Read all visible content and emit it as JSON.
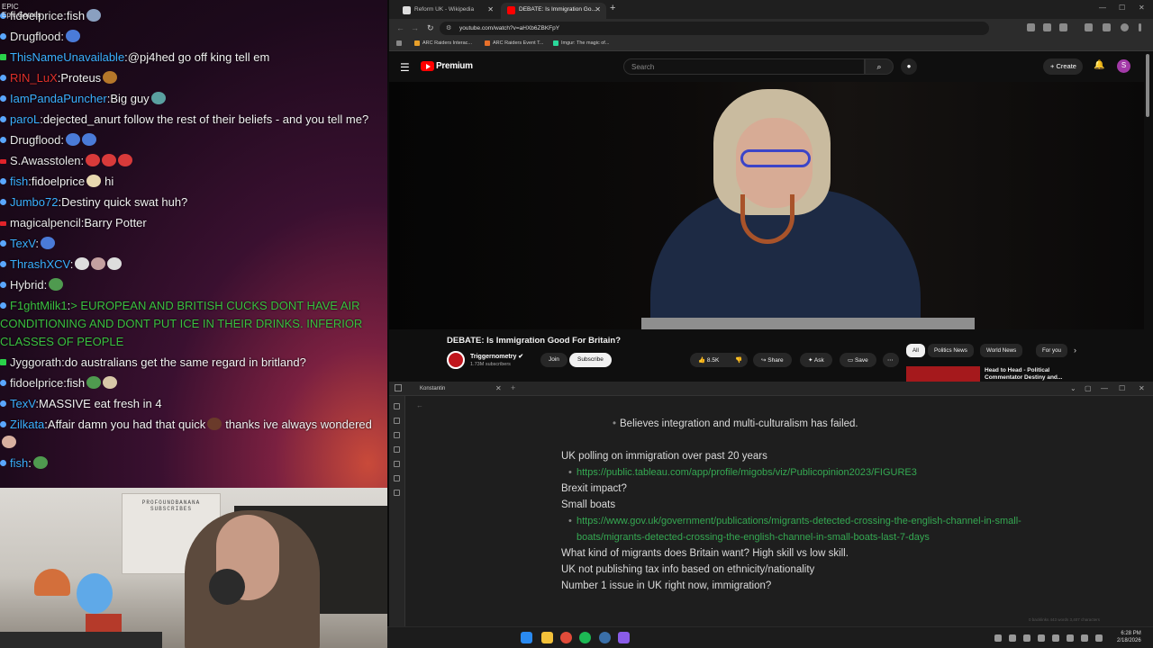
{
  "chat": {
    "epic_tag": "EPIC\nEpic Games",
    "messages": [
      {
        "badge": "sub",
        "user": "fidoelprice",
        "user_color": "#e8e8e8",
        "text": "fish",
        "emotes": [
          "#8aa0c0"
        ]
      },
      {
        "badge": "sub",
        "user": "Drugflood",
        "user_color": "#e8e8e8",
        "text": "",
        "emotes": [
          "#4a7bd8"
        ]
      },
      {
        "badge": "green",
        "user": "ThisNameUnavailable",
        "user_color": "#3ab0ff",
        "text": "@pj4hed go off king tell em",
        "emotes": []
      },
      {
        "badge": "sub",
        "user": "RIN_LuX",
        "user_color": "#e0302a",
        "text": "Proteus",
        "emotes": [
          "#b5772a"
        ]
      },
      {
        "badge": "sub",
        "user": "IamPandaPuncher",
        "user_color": "#3ab0ff",
        "text": "Big guy",
        "emotes": [
          "#5aa0a0"
        ]
      },
      {
        "badge": "sub",
        "user": "paroL",
        "user_color": "#3ab0ff",
        "text": "dejected_anurt follow the rest of their beliefs - and you tell me?",
        "emotes": []
      },
      {
        "badge": "sub",
        "user": "Drugflood",
        "user_color": "#e8e8e8",
        "text": "",
        "emotes": [
          "#4a7bd8",
          "#4a7bd8"
        ]
      },
      {
        "badge": "red",
        "user": "S.Awasstolen",
        "user_color": "#e8e8e8",
        "text": "",
        "emotes": [
          "#d83a3a",
          "#d83a3a",
          "#d83a3a"
        ]
      },
      {
        "badge": "sub",
        "user": "fish",
        "user_color": "#3ab0ff",
        "text": "fidoelprice",
        "emotes": [
          "#e8d8b0"
        ],
        "tail": "hi"
      },
      {
        "badge": "sub",
        "user": "Jumbo72",
        "user_color": "#3ab0ff",
        "text": "Destiny quick swat huh?",
        "emotes": []
      },
      {
        "badge": "red",
        "user": "magicalpencil",
        "user_color": "#e8e8e8",
        "text": "Barry Potter",
        "emotes": []
      },
      {
        "badge": "sub",
        "user": "TexV",
        "user_color": "#3ab0ff",
        "text": "",
        "emotes": [
          "#4a7bd8"
        ]
      },
      {
        "badge": "sub",
        "user": "ThrashXCV",
        "user_color": "#3ab0ff",
        "text": "",
        "emotes": [
          "#dddddd",
          "#c4a0a0",
          "#dddddd"
        ]
      },
      {
        "badge": "sub",
        "user": "Hybrid",
        "user_color": "#e8e8e8",
        "text": "",
        "emotes": [
          "#4f9a4f"
        ]
      },
      {
        "badge": "sub",
        "user": "F1ghtMilk1",
        "user_color": "#3ac040",
        "text": "> EUROPEAN AND BRITISH CUCKS DONT HAVE AIR CONDITIONING AND DONT PUT ICE IN THEIR DRINKS. INFERIOR CLASSES OF PEOPLE",
        "emotes": [],
        "shout": true
      },
      {
        "badge": "green",
        "user": "Jyggorath",
        "user_color": "#e8e8e8",
        "text": "do australians get the same regard in britland?",
        "emotes": []
      },
      {
        "badge": "sub",
        "user": "fidoelprice",
        "user_color": "#e8e8e8",
        "text": "fish",
        "emotes": [
          "#4f9a4f",
          "#d8c8a8"
        ]
      },
      {
        "badge": "sub",
        "user": "TexV",
        "user_color": "#3ab0ff",
        "text": "MASSIVE eat fresh in 4",
        "emotes": []
      },
      {
        "badge": "sub",
        "user": "Zilkata",
        "user_color": "#3ab0ff",
        "text": "Affair damn you had that quick",
        "emotes": [
          "#6a3a2a"
        ],
        "tail": "thanks ive always wondered",
        "tail_emotes": [
          "#d8b0a0"
        ]
      },
      {
        "badge": "sub",
        "user": "fish",
        "user_color": "#3ab0ff",
        "text": "",
        "emotes": [
          "#4f9a4f"
        ]
      }
    ]
  },
  "webcam": {
    "poster_text": "PROFOUNDBANANA SUBSCRIBES"
  },
  "browser": {
    "tabs": [
      {
        "title": "Reform UK - Wikipedia",
        "favicon_color": "#dddddd"
      },
      {
        "title": "DEBATE: Is Immigration Go...",
        "favicon_color": "#ff0000"
      }
    ],
    "url": "youtube.com/watch?v=aHXb6ZBKFpY",
    "bookmarks": [
      {
        "label": "ARC Raiders Interac...",
        "color": "#e8a02a"
      },
      {
        "label": "ARC Raiders Event T...",
        "color": "#e8702a"
      },
      {
        "label": "Imgur: The magic of...",
        "color": "#2ad89a"
      }
    ]
  },
  "youtube": {
    "brand": "Premium",
    "search_placeholder": "Search",
    "create_label": "Create",
    "avatar_letter": "S",
    "video_title": "DEBATE: Is Immigration Good For Britain?",
    "channel_name": "Triggernometry ✔",
    "channel_subs": "1.73M subscribers",
    "join_label": "Join",
    "subscribe_label": "Subscribe",
    "likes": "8.5K",
    "share_label": "Share",
    "ask_label": "Ask",
    "save_label": "Save",
    "chips": [
      "All",
      "Politics News",
      "World News",
      "For you"
    ],
    "rec_title": "Head to Head - Political\nCommentator Destiny and..."
  },
  "notes": {
    "tab_title": "Konstantin",
    "lines": [
      {
        "kind": "deep-bullet",
        "text": "Believes integration and multi-culturalism has failed."
      },
      {
        "kind": "gap",
        "text": ""
      },
      {
        "kind": "text",
        "text": "UK polling on immigration over past 20 years"
      },
      {
        "kind": "link",
        "text": "https://public.tableau.com/app/profile/migobs/viz/Publicopinion2023/FIGURE3"
      },
      {
        "kind": "text",
        "text": "Brexit impact?"
      },
      {
        "kind": "text",
        "text": "Small boats"
      },
      {
        "kind": "link",
        "text": "https://www.gov.uk/government/publications/migrants-detected-crossing-the-english-channel-in-small-boats/migrants-detected-crossing-the-english-channel-in-small-boats-last-7-days"
      },
      {
        "kind": "text",
        "text": "What kind of migrants does Britain want? High skill vs low skill."
      },
      {
        "kind": "text",
        "text": "UK not publishing tax info based on ethnicity/nationality"
      },
      {
        "kind": "text",
        "text": "Number 1 issue in UK right now, immigration?"
      }
    ],
    "status": "0 backlinks   443 words   3,407 characters"
  },
  "taskbar": {
    "time": "6:28 PM",
    "date": "2/18/2026"
  }
}
